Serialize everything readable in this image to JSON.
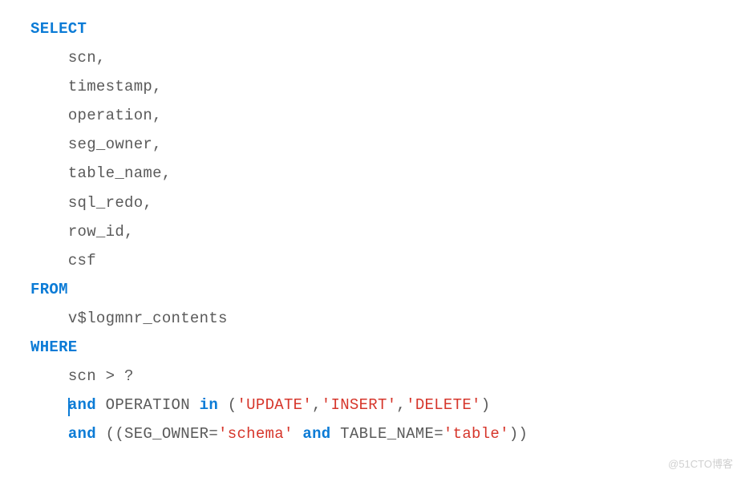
{
  "code": {
    "select_kw": "SELECT",
    "col1": "scn,",
    "col2": "timestamp,",
    "col3": "operation,",
    "col4": "seg_owner,",
    "col5": "table_name,",
    "col6": "sql_redo,",
    "col7": "row_id,",
    "col8": "csf",
    "from_kw": "FROM",
    "table": "v$logmnr_contents",
    "where_kw": "WHERE",
    "cond1": "scn > ?",
    "and1": "and",
    "op_field": " OPERATION ",
    "in_kw": "in",
    "lparen1": " (",
    "str_update": "'UPDATE'",
    "comma1": ",",
    "str_insert": "'INSERT'",
    "comma2": ",",
    "str_delete": "'DELETE'",
    "rparen1": ")",
    "and2": "and",
    "seg_part": " ((SEG_OWNER=",
    "str_schema": "'schema'",
    "space1": " ",
    "and3": "and",
    "tbl_part": " TABLE_NAME=",
    "str_table": "'table'",
    "rparen2": "))"
  },
  "watermark": "@51CTO博客"
}
